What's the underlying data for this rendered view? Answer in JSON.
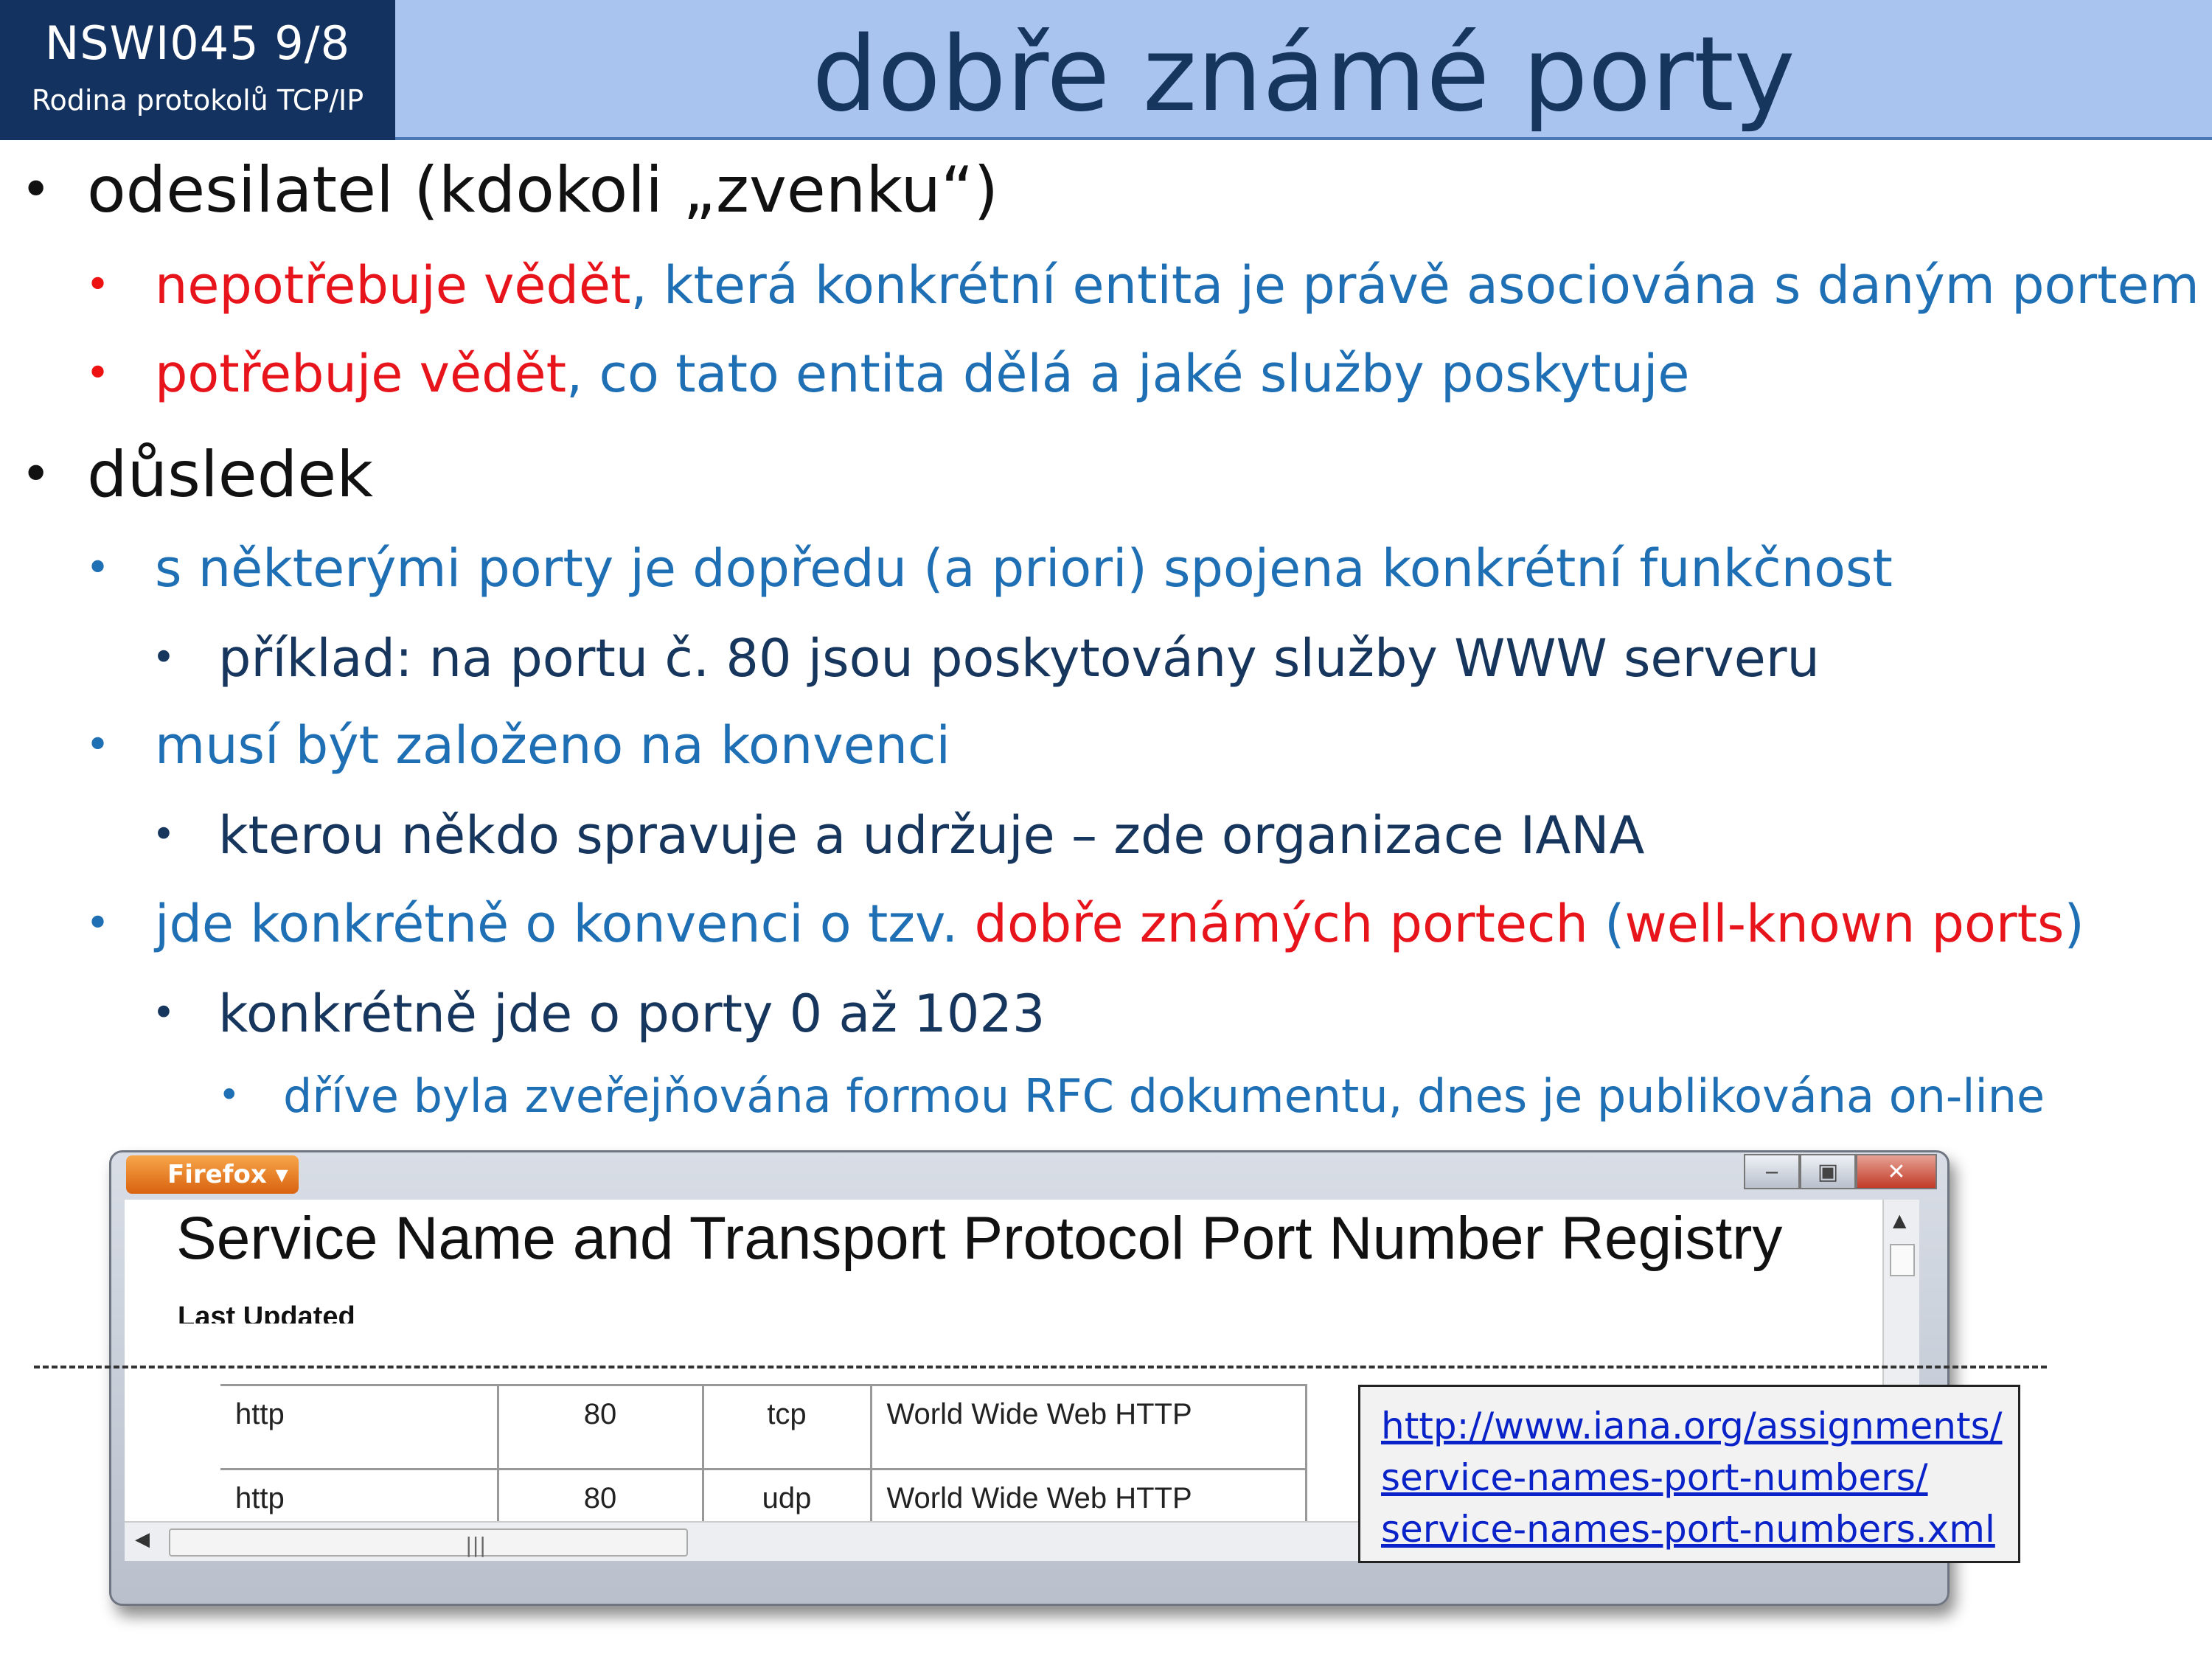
{
  "header": {
    "course_code": "NSWI045   9/8",
    "subtitle": "Rodina protokolů TCP/IP",
    "title": "dobře známé porty"
  },
  "bullets": {
    "b1": "odesilatel (kdokoli „zvenku“)",
    "b1_1_red": "nepotřebuje vědět",
    "b1_1_rest": ", která konkrétní entita je právě asociována s daným portem",
    "b1_2_red": "potřebuje vědět",
    "b1_2_rest": ", co tato entita dělá a jaké služby poskytuje",
    "b2": "důsledek",
    "b2_1": "s některými porty je dopředu (a priori) spojena konkrétní funkčnost",
    "b2_1_1": "příklad: na portu č. 80 jsou poskytovány služby WWW serveru",
    "b2_2": "musí být založeno na konvenci",
    "b2_2_1": "kterou někdo spravuje  a udržuje – zde organizace IANA",
    "b2_3_a": "jde konkrétně o konvenci o tzv. ",
    "b2_3_red": "dobře známých portech",
    "b2_3_b": " (",
    "b2_3_red2": "well-known ports",
    "b2_3_c": ")",
    "b2_3_1": "konkrétně jde o porty 0 až 1023",
    "b2_3_1_1": "dříve byla zveřejňována formou RFC dokumentu, dnes je publikována on-line"
  },
  "browser": {
    "app_button": "Firefox",
    "page_heading": "Service Name and Transport Protocol Port Number Registry",
    "last_updated_label": "Last Updated",
    "rows": [
      {
        "service": "http",
        "port": "80",
        "proto": "tcp",
        "desc": "World Wide Web HTTP"
      },
      {
        "service": "http",
        "port": "80",
        "proto": "udp",
        "desc": "World Wide Web HTTP"
      }
    ]
  },
  "link": {
    "line1": "http://www.iana.org/assignments/",
    "line2": "service-names-port-numbers/",
    "line3": "service-names-port-numbers.xml"
  },
  "colors": {
    "header_dark": "#14325f",
    "header_band": "#a9c4ee",
    "red": "#e8141c",
    "blue": "#1f6fb5"
  }
}
